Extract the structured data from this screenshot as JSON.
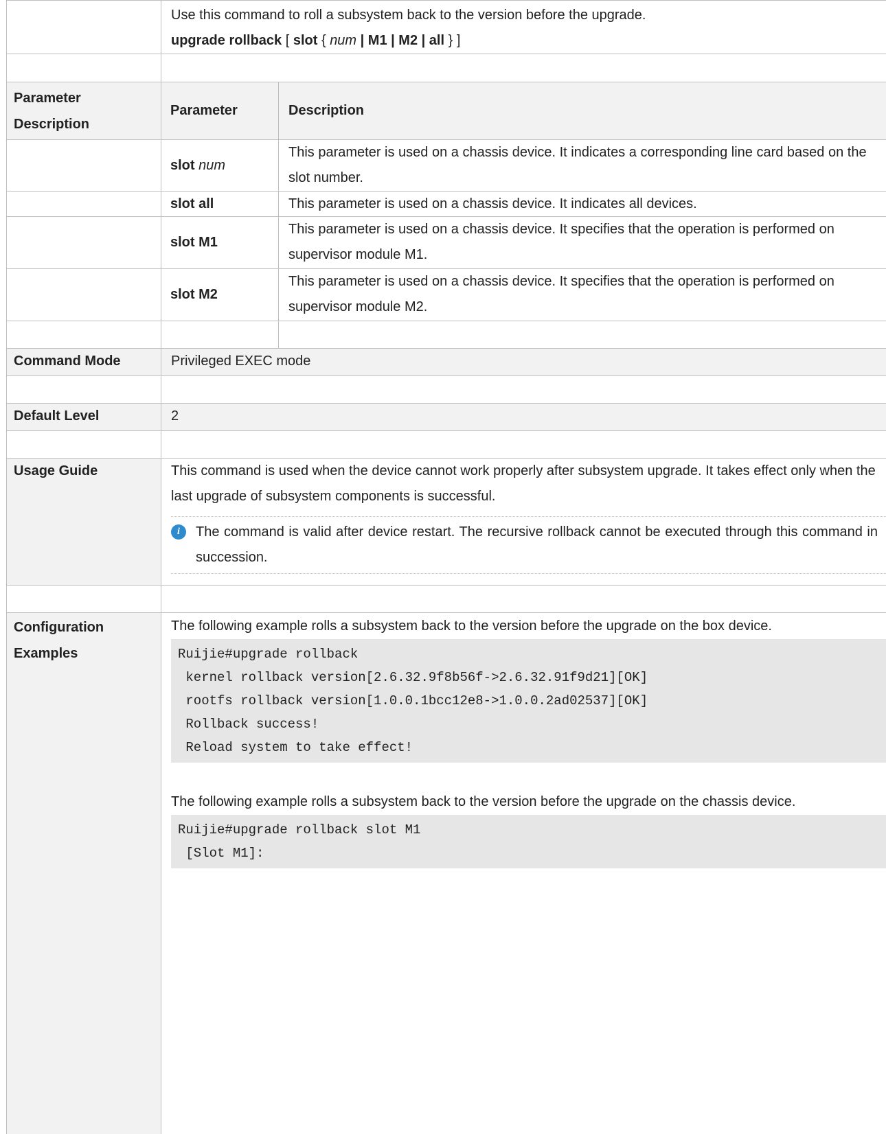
{
  "header": {
    "description": "Use this command to roll a subsystem back to the version before the upgrade.",
    "syntax": {
      "cmd": "upgrade rollback",
      "open_bracket": " [ ",
      "slot": "slot",
      "open_brace": " { ",
      "num": "num",
      "options": " | M1 | M2 | all",
      "close": " } ]"
    }
  },
  "params": {
    "label": "Parameter Description",
    "col_param": "Parameter",
    "col_desc": "Description",
    "rows": [
      {
        "kw": "slot",
        "arg": "num",
        "desc": "This parameter is used on a chassis device. It indicates a corresponding line card based on the slot number."
      },
      {
        "kw": "slot all",
        "arg": "",
        "desc": "This parameter is used on a chassis device. It indicates all devices."
      },
      {
        "kw": "slot M1",
        "arg": "",
        "desc": "This parameter is used on a chassis device. It specifies that the operation is performed on supervisor module M1."
      },
      {
        "kw": "slot M2",
        "arg": "",
        "desc": "This parameter is used on a chassis device. It specifies that the operation is performed on supervisor module M2."
      }
    ]
  },
  "command_mode": {
    "label": "Command Mode",
    "value": "Privileged EXEC mode"
  },
  "default_level": {
    "label": "Default Level",
    "value": "2"
  },
  "usage": {
    "label": "Usage Guide",
    "text": "This command is used when the device cannot work properly after subsystem upgrade. It takes effect only when the last upgrade of subsystem components is successful.",
    "note_icon": "info-icon",
    "note": "The command is valid after device restart. The recursive rollback cannot be executed through this command in succession."
  },
  "examples": {
    "label_line1": "Configuration",
    "label_line2": "Examples",
    "ex1_text": "The following example rolls a subsystem back to the version before the upgrade on the box device.",
    "ex1_code": "Ruijie#upgrade rollback\n kernel rollback version[2.6.32.9f8b56f->2.6.32.91f9d21][OK]\n rootfs rollback version[1.0.0.1bcc12e8->1.0.0.2ad02537][OK]\n Rollback success!\n Reload system to take effect!",
    "ex2_text": "The following example rolls a subsystem back to the version before the upgrade on the chassis device.",
    "ex2_code": "Ruijie#upgrade rollback slot M1\n [Slot M1]:"
  }
}
